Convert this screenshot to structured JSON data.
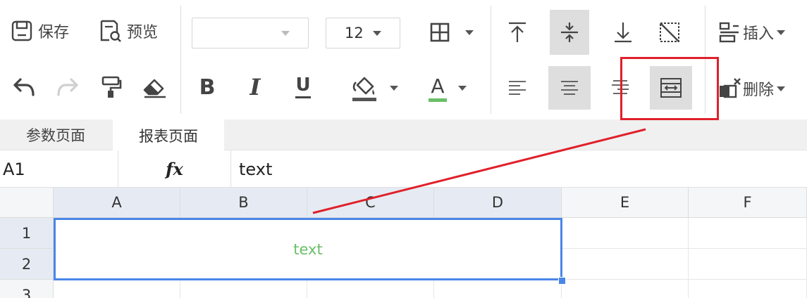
{
  "toolbar": {
    "save_label": "保存",
    "preview_label": "预览",
    "font_family_value": "",
    "font_size_value": "12",
    "bold_label": "B",
    "italic_label": "I",
    "underline_label": "U",
    "font_color_label": "A",
    "insert_label": "插入",
    "delete_label": "删除",
    "colors": {
      "active_bg": "#dedede",
      "fill_bar": "#555555",
      "font_color_bar": "#6abf69"
    }
  },
  "tabs": [
    {
      "label": "参数页面",
      "active": false
    },
    {
      "label": "报表页面",
      "active": true
    }
  ],
  "formula_bar": {
    "cell_ref": "A1",
    "fx_label": "fx",
    "value": "text"
  },
  "grid": {
    "columns": [
      "A",
      "B",
      "C",
      "D",
      "E",
      "F"
    ],
    "rows": [
      "1",
      "2",
      "3"
    ],
    "selected_range": "A1:D2",
    "merged_cell_text": "text",
    "colors": {
      "selection": "#4a86e8",
      "cell_text": "#6abf69"
    }
  },
  "annotation": {
    "color": "#e0202a",
    "highlighted_tool": "merge-cells-icon"
  }
}
